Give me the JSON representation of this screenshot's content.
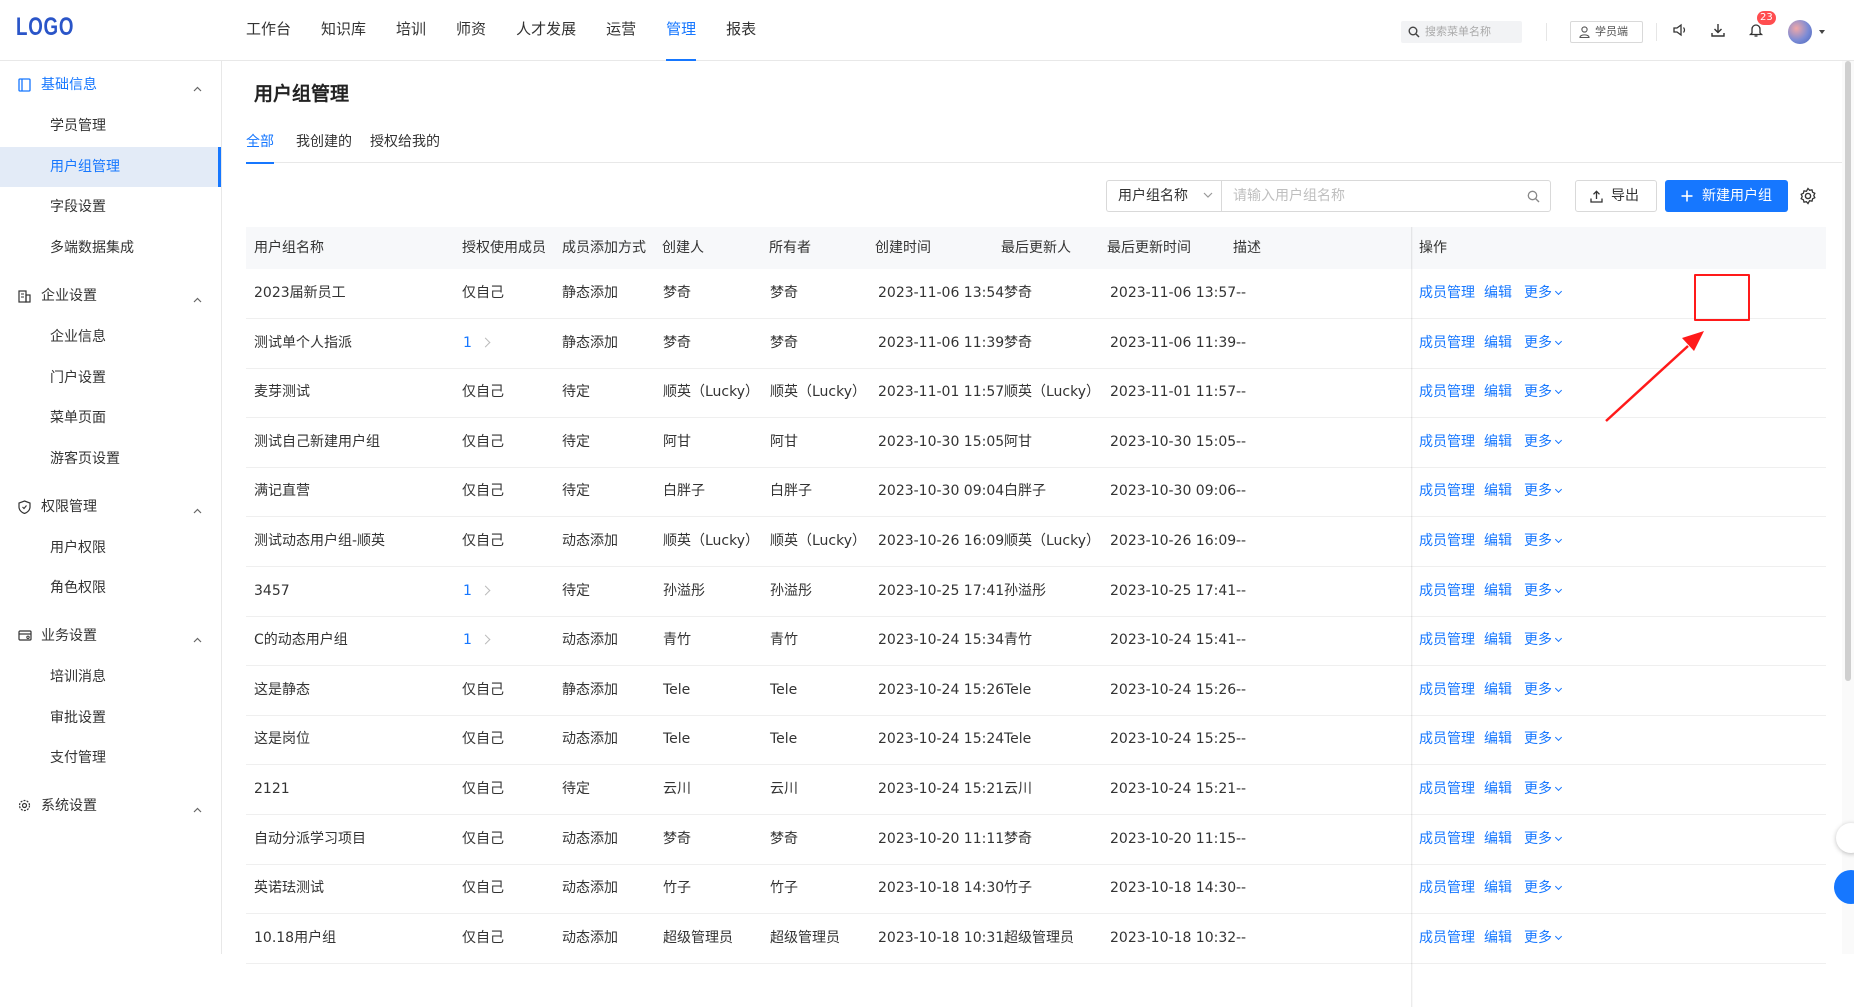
{
  "app": {
    "logo": "LOGO"
  },
  "topnav": {
    "items": [
      "工作台",
      "知识库",
      "培训",
      "师资",
      "人才发展",
      "运营",
      "管理",
      "报表"
    ],
    "active": "管理",
    "search_placeholder": "搜索菜单名称",
    "role_button": "学员端",
    "notification_count": "23"
  },
  "sidebar": {
    "groups": [
      {
        "label": "基础信息",
        "icon": "book-icon",
        "items": [
          "学员管理",
          "用户组管理",
          "字段设置",
          "多端数据集成"
        ]
      },
      {
        "label": "企业设置",
        "icon": "building-icon",
        "items": [
          "企业信息",
          "门户设置",
          "菜单页面",
          "游客页设置"
        ]
      },
      {
        "label": "权限管理",
        "icon": "shield-icon",
        "items": [
          "用户权限",
          "角色权限"
        ]
      },
      {
        "label": "业务设置",
        "icon": "card-icon",
        "items": [
          "培训消息",
          "审批设置",
          "支付管理"
        ]
      },
      {
        "label": "系统设置",
        "icon": "gear-icon",
        "items": []
      }
    ],
    "active_item": "用户组管理"
  },
  "page": {
    "title": "用户组管理",
    "tabs": [
      "全部",
      "我创建的",
      "授权给我的"
    ],
    "active_tab": "全部",
    "filter": {
      "select_label": "用户组名称",
      "input_placeholder": "请输入用户组名称"
    },
    "export_label": "导出",
    "new_label": "新建用户组"
  },
  "table": {
    "columns": [
      "用户组名称",
      "授权使用成员",
      "成员添加方式",
      "创建人",
      "所有者",
      "创建时间",
      "最后更新人",
      "最后更新时间",
      "描述",
      "操作"
    ],
    "actions": {
      "members": "成员管理",
      "edit": "编辑",
      "more": "更多"
    },
    "rows": [
      {
        "name": "2023届新员工",
        "auth": "仅自己",
        "method": "静态添加",
        "creator": "梦奇",
        "owner": "梦奇",
        "created": "2023-11-06 13:54",
        "updater": "梦奇",
        "updated": "2023-11-06 13:57",
        "desc": "--"
      },
      {
        "name": "测试单个人指派",
        "auth": "1",
        "method": "静态添加",
        "creator": "梦奇",
        "owner": "梦奇",
        "created": "2023-11-06 11:39",
        "updater": "梦奇",
        "updated": "2023-11-06 11:39",
        "desc": "--"
      },
      {
        "name": "麦芽测试",
        "auth": "仅自己",
        "method": "待定",
        "creator": "顺英（Lucky）",
        "owner": "顺英（Lucky）",
        "created": "2023-11-01 11:57",
        "updater": "顺英（Lucky）",
        "updated": "2023-11-01 11:57",
        "desc": "--"
      },
      {
        "name": "测试自己新建用户组",
        "auth": "仅自己",
        "method": "待定",
        "creator": "阿甘",
        "owner": "阿甘",
        "created": "2023-10-30 15:05",
        "updater": "阿甘",
        "updated": "2023-10-30 15:05",
        "desc": "--"
      },
      {
        "name": "满记直营",
        "auth": "仅自己",
        "method": "待定",
        "creator": "白胖子",
        "owner": "白胖子",
        "created": "2023-10-30 09:04",
        "updater": "白胖子",
        "updated": "2023-10-30 09:06",
        "desc": "--"
      },
      {
        "name": "测试动态用户组-顺英",
        "auth": "仅自己",
        "method": "动态添加",
        "creator": "顺英（Lucky）",
        "owner": "顺英（Lucky）",
        "created": "2023-10-26 16:09",
        "updater": "顺英（Lucky）",
        "updated": "2023-10-26 16:09",
        "desc": "--"
      },
      {
        "name": "3457",
        "auth": "1",
        "method": "待定",
        "creator": "孙溢彤",
        "owner": "孙溢彤",
        "created": "2023-10-25 17:41",
        "updater": "孙溢彤",
        "updated": "2023-10-25 17:41",
        "desc": "--"
      },
      {
        "name": "C的动态用户组",
        "auth": "1",
        "method": "动态添加",
        "creator": "青竹",
        "owner": "青竹",
        "created": "2023-10-24 15:34",
        "updater": "青竹",
        "updated": "2023-10-24 15:41",
        "desc": "--"
      },
      {
        "name": "这是静态",
        "auth": "仅自己",
        "method": "静态添加",
        "creator": "Tele",
        "owner": "Tele",
        "created": "2023-10-24 15:26",
        "updater": "Tele",
        "updated": "2023-10-24 15:26",
        "desc": "--"
      },
      {
        "name": "这是岗位",
        "auth": "仅自己",
        "method": "动态添加",
        "creator": "Tele",
        "owner": "Tele",
        "created": "2023-10-24 15:24",
        "updater": "Tele",
        "updated": "2023-10-24 15:25",
        "desc": "--"
      },
      {
        "name": "2121",
        "auth": "仅自己",
        "method": "待定",
        "creator": "云川",
        "owner": "云川",
        "created": "2023-10-24 15:21",
        "updater": "云川",
        "updated": "2023-10-24 15:21",
        "desc": "--"
      },
      {
        "name": "自动分派学习项目",
        "auth": "仅自己",
        "method": "动态添加",
        "creator": "梦奇",
        "owner": "梦奇",
        "created": "2023-10-20 11:11",
        "updater": "梦奇",
        "updated": "2023-10-20 11:15",
        "desc": "--"
      },
      {
        "name": "英诺珐测试",
        "auth": "仅自己",
        "method": "动态添加",
        "creator": "竹子",
        "owner": "竹子",
        "created": "2023-10-18 14:30",
        "updater": "竹子",
        "updated": "2023-10-18 14:30",
        "desc": "--"
      },
      {
        "name": "10.18用户组",
        "auth": "仅自己",
        "method": "动态添加",
        "creator": "超级管理员",
        "owner": "超级管理员",
        "created": "2023-10-18 10:31",
        "updater": "超级管理员",
        "updated": "2023-10-18 10:32",
        "desc": "--"
      }
    ]
  },
  "colors": {
    "primary": "#1677ff",
    "annotation": "#ff1a1a",
    "sidebar_active_bg": "#e3ebf7"
  }
}
